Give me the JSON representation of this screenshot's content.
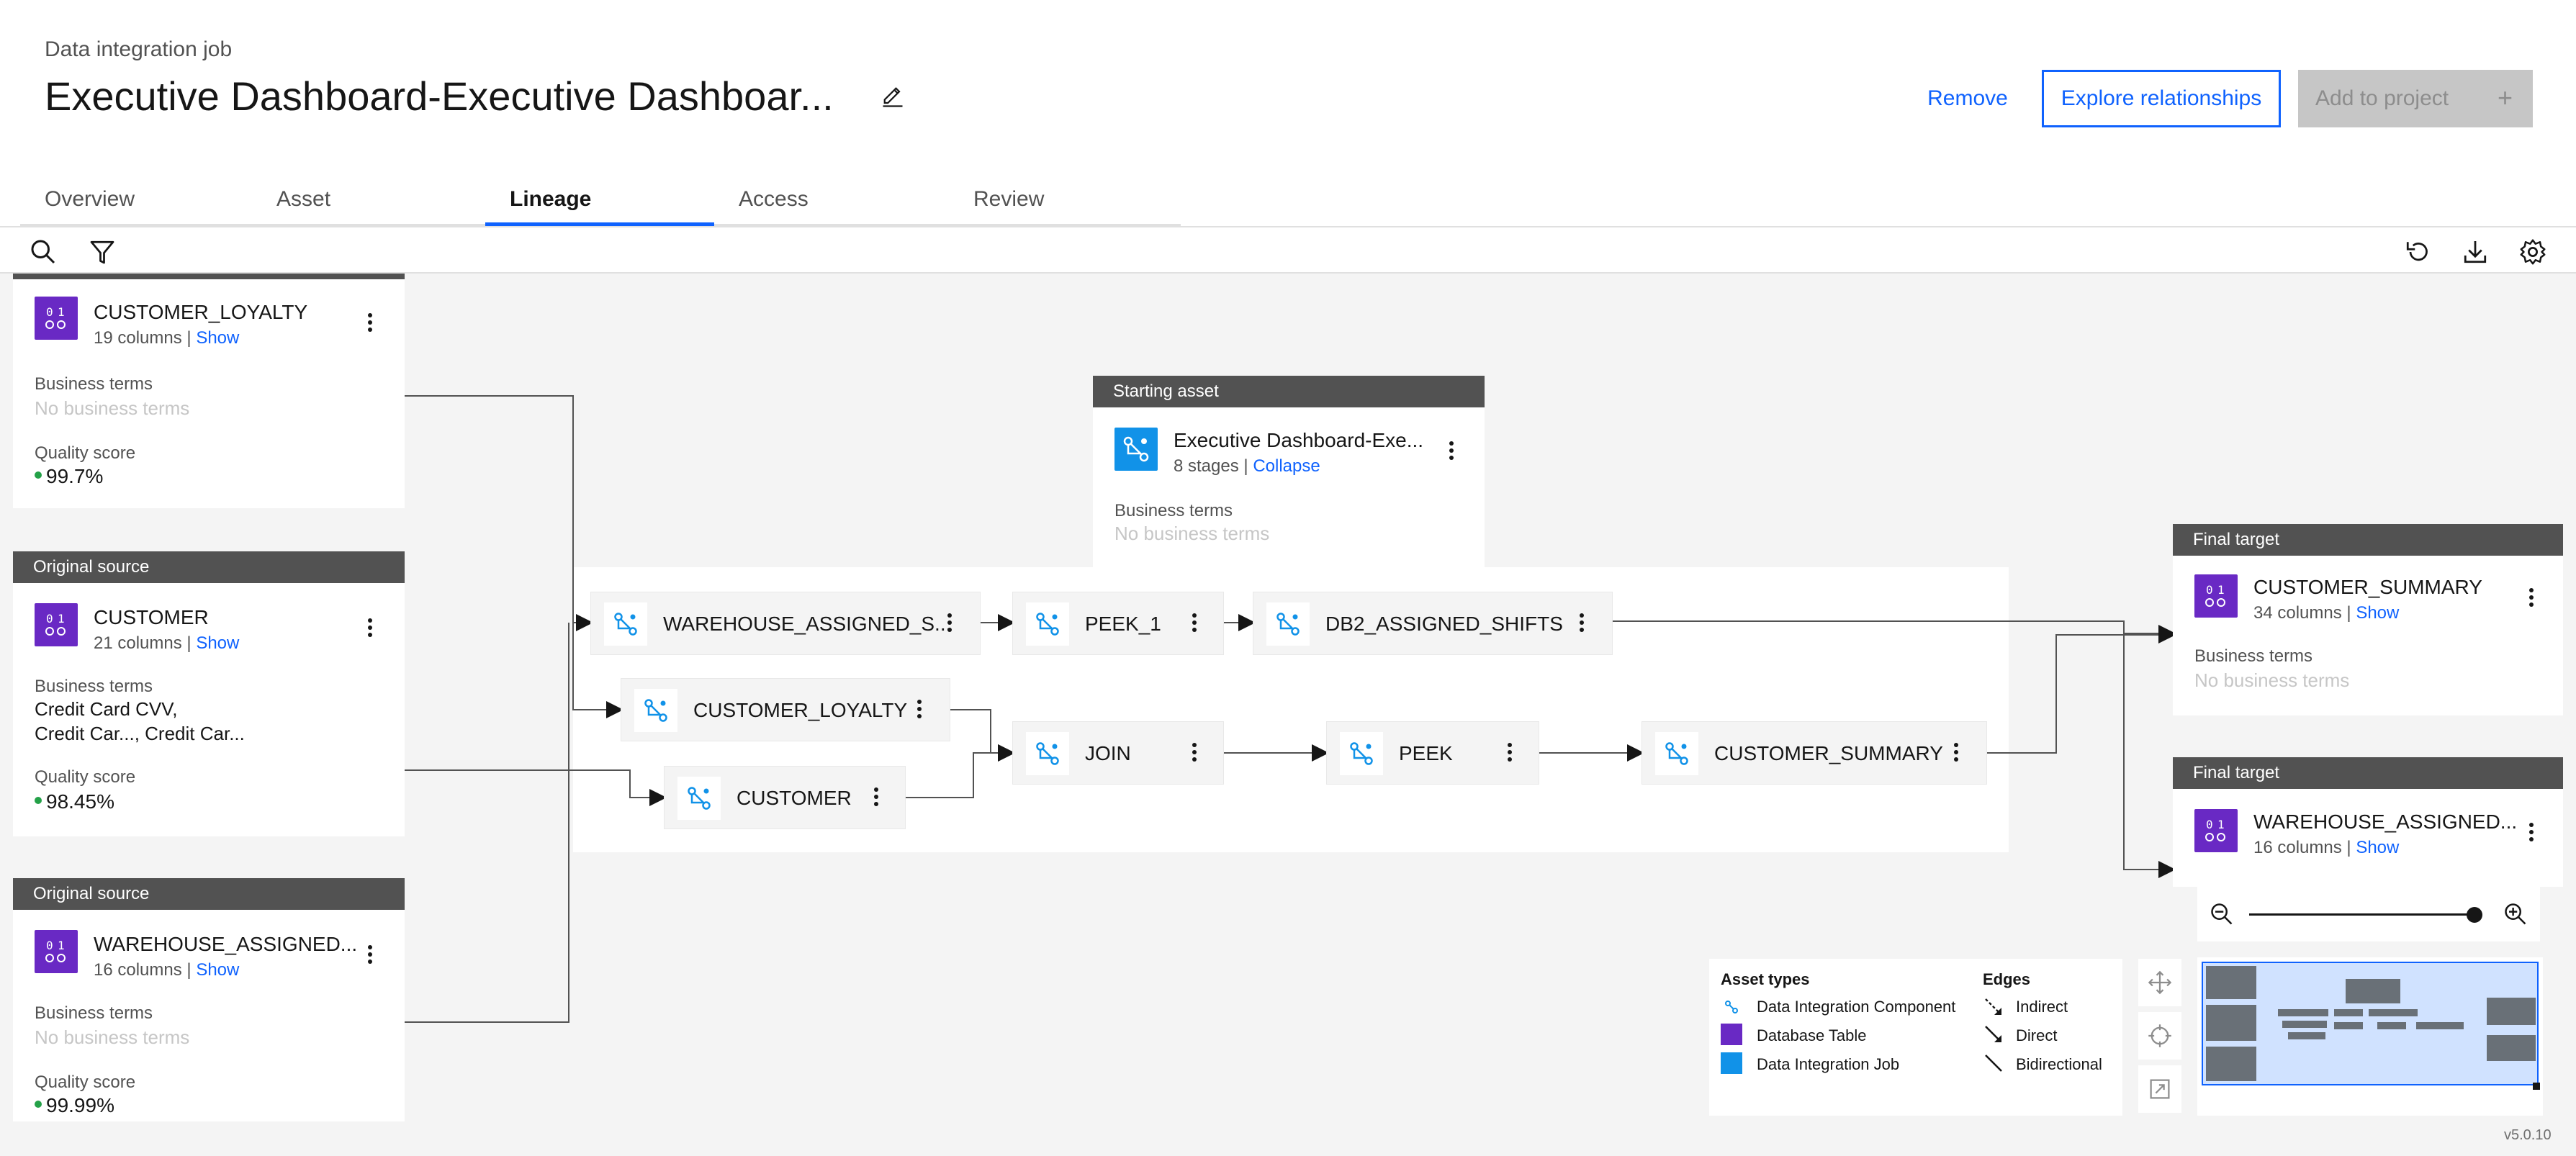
{
  "header": {
    "eyebrow": "Data integration job",
    "title": "Executive Dashboard-Executive Dashboar...",
    "remove_label": "Remove",
    "explore_label": "Explore relationships",
    "add_label": "Add to project",
    "add_icon": "+"
  },
  "tabs": [
    {
      "label": "Overview"
    },
    {
      "label": "Asset"
    },
    {
      "label": "Lineage",
      "active": true
    },
    {
      "label": "Access"
    },
    {
      "label": "Review"
    }
  ],
  "sources": [
    {
      "tag": "",
      "name": "CUSTOMER_LOYALTY",
      "columns": "19 columns",
      "show": "Show",
      "business_terms_label": "Business terms",
      "business_terms": "No business terms",
      "quality_label": "Quality score",
      "quality": "99.7%"
    },
    {
      "tag": "Original source",
      "name": "CUSTOMER",
      "columns": "21 columns",
      "show": "Show",
      "business_terms_label": "Business terms",
      "business_terms_line1": "Credit Card CVV,",
      "business_terms_line2": "Credit Car..., Credit Car...",
      "quality_label": "Quality score",
      "quality": "98.45%"
    },
    {
      "tag": "Original source",
      "name": "WAREHOUSE_ASSIGNED...",
      "columns": "16 columns",
      "show": "Show",
      "business_terms_label": "Business terms",
      "business_terms": "No business terms",
      "quality_label": "Quality score",
      "quality": "99.99%"
    }
  ],
  "starting_asset": {
    "tag": "Starting asset",
    "name": "Executive Dashboard-Exe...",
    "stages": "8 stages",
    "collapse": "Collapse",
    "business_terms_label": "Business terms",
    "business_terms": "No business terms"
  },
  "nodes": {
    "warehouse_assigned": "WAREHOUSE_ASSIGNED_S...",
    "peek_1": "PEEK_1",
    "db2_assigned_shifts": "DB2_ASSIGNED_SHIFTS",
    "customer_loyalty": "CUSTOMER_LOYALTY",
    "customer": "CUSTOMER",
    "join": "JOIN",
    "peek": "PEEK",
    "customer_summary": "CUSTOMER_SUMMARY"
  },
  "targets": [
    {
      "tag": "Final target",
      "name": "CUSTOMER_SUMMARY",
      "columns": "34 columns",
      "show": "Show",
      "business_terms_label": "Business terms",
      "business_terms": "No business terms"
    },
    {
      "tag": "Final target",
      "name": "WAREHOUSE_ASSIGNED...",
      "columns": "16 columns",
      "show": "Show"
    }
  ],
  "legend": {
    "asset_types_title": "Asset types",
    "asset_types": [
      "Data Integration Component",
      "Database Table",
      "Data Integration Job"
    ],
    "edges_title": "Edges",
    "edges": [
      "Indirect",
      "Direct",
      "Bidirectional"
    ]
  },
  "zoom": {
    "level": 1.0
  },
  "version": "v5.0.10",
  "colors": {
    "accent": "#0f62fe",
    "table_icon": "#6929c4",
    "job_icon": "#1192e8",
    "quality_dot": "#24a148",
    "tag_bg": "#525252"
  },
  "icons": {
    "edit": "pencil-icon",
    "search": "search-icon",
    "filter": "filter-icon",
    "reset": "reset-icon",
    "download": "download-icon",
    "settings": "gear-icon"
  }
}
